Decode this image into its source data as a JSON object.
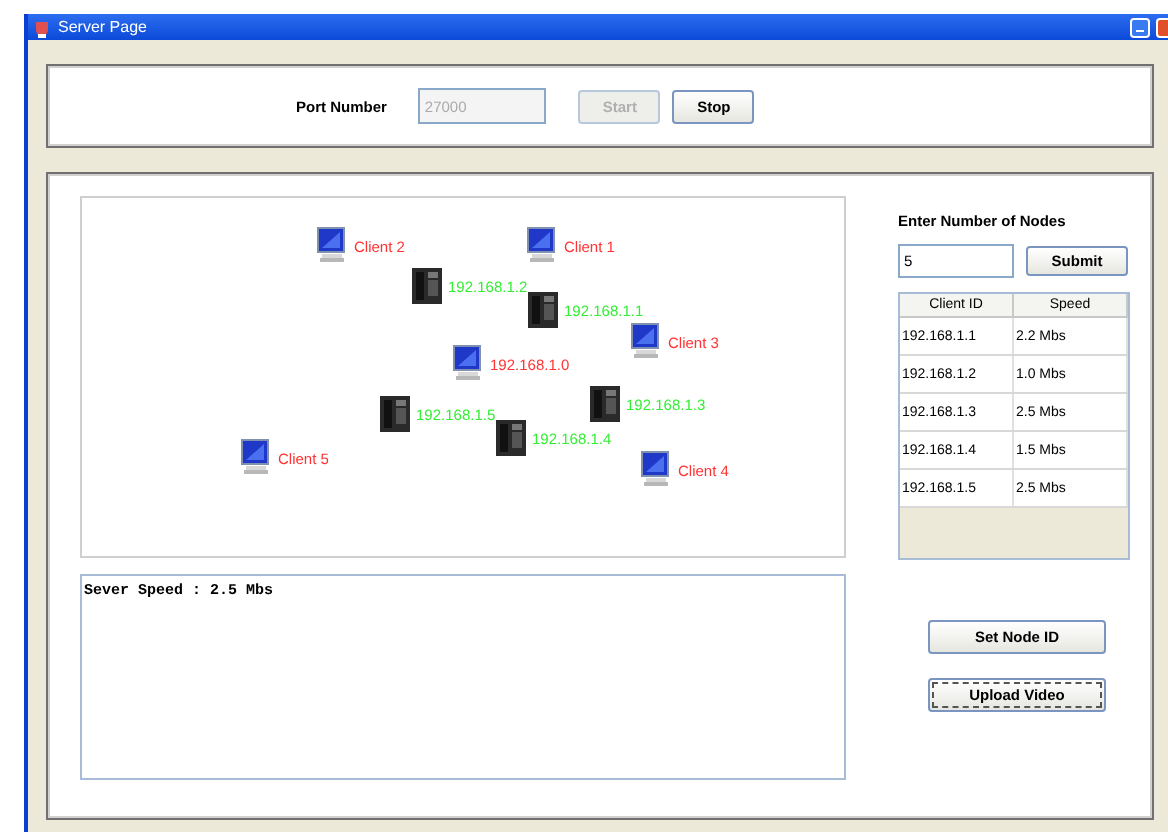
{
  "window": {
    "title": "Server Page"
  },
  "port_panel": {
    "label": "Port Number",
    "port_field": {
      "value": "27000",
      "disabled": true
    },
    "buttons": [
      {
        "label": "Start",
        "disabled": true
      },
      {
        "label": "Stop",
        "disabled": false
      }
    ]
  },
  "network_map": {
    "nodes": [
      {
        "kind": "computer",
        "label": "Client 2",
        "color": "#ff3333"
      },
      {
        "kind": "computer",
        "label": "Client 1",
        "color": "#ff3333"
      },
      {
        "kind": "server",
        "label": "192.168.1.2",
        "color": "#33ee33"
      },
      {
        "kind": "server",
        "label": "192.168.1.1",
        "color": "#33ee33"
      },
      {
        "kind": "computer",
        "label": "Client 3",
        "color": "#ff3333"
      },
      {
        "kind": "computer",
        "label": "192.168.1.0",
        "color": "#ff3333"
      },
      {
        "kind": "server",
        "label": "192.168.1.3",
        "color": "#33ee33"
      },
      {
        "kind": "server",
        "label": "192.168.1.5",
        "color": "#33ee33"
      },
      {
        "kind": "server",
        "label": "192.168.1.4",
        "color": "#33ee33"
      },
      {
        "kind": "computer",
        "label": "Client 5",
        "color": "#ff3333"
      },
      {
        "kind": "computer",
        "label": "Client 4",
        "color": "#ff3333"
      }
    ]
  },
  "log": {
    "text": "Sever Speed : 2.5 Mbs"
  },
  "nodes_panel": {
    "label": "Enter Number of Nodes",
    "nodes_field": {
      "value": "5"
    },
    "submit_button": "Submit"
  },
  "table": {
    "columns": [
      "Client ID",
      "Speed"
    ],
    "rows": [
      [
        "192.168.1.1",
        "2.2 Mbs"
      ],
      [
        "192.168.1.2",
        "1.0 Mbs"
      ],
      [
        "192.168.1.3",
        "2.5 Mbs"
      ],
      [
        "192.168.1.4",
        "1.5 Mbs"
      ],
      [
        "192.168.1.5",
        "2.5 Mbs"
      ]
    ]
  },
  "actions": [
    {
      "label": "Set Node ID",
      "focused": false
    },
    {
      "label": "Upload Video",
      "focused": true
    }
  ]
}
